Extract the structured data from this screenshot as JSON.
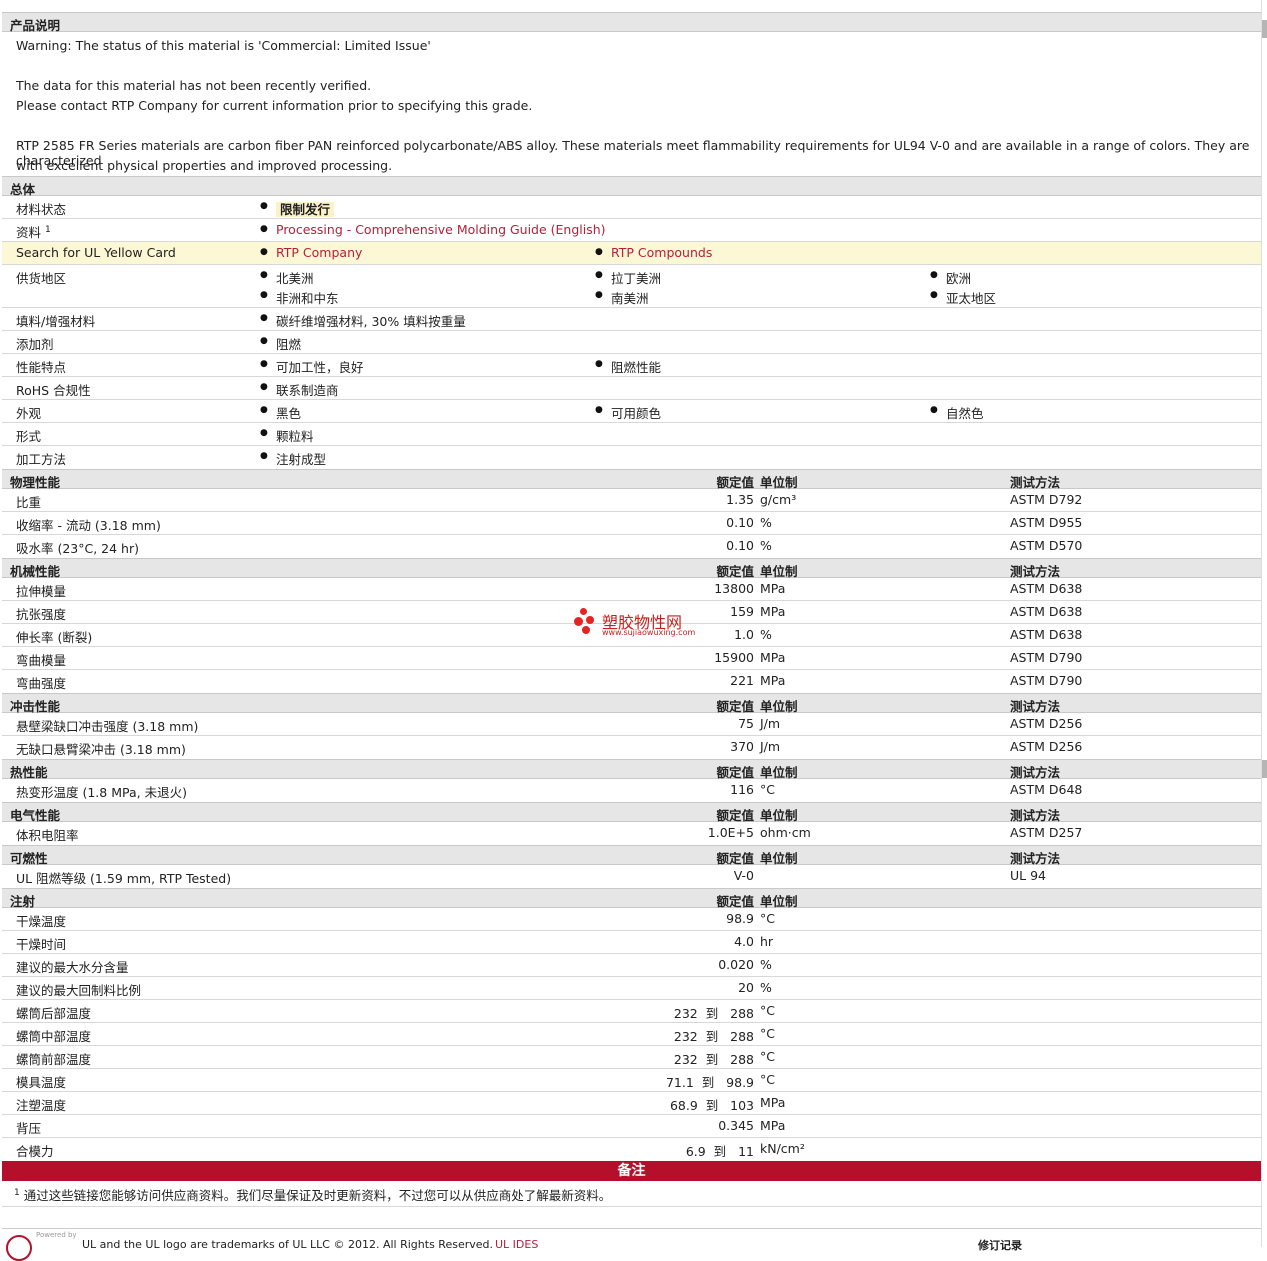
{
  "product": {
    "header": "产品说明",
    "lines": [
      "Warning: The status of this material is 'Commercial: Limited Issue'",
      "The data for this material has not been recently verified.",
      "Please contact RTP Company for current information prior to specifying this grade.",
      "RTP 2585 FR Series materials are carbon fiber PAN reinforced polycarbonate/ABS alloy. These materials meet flammability requirements for UL94 V-0 and are available in a range of colors. They are characterized",
      "with excellent physical properties and improved processing."
    ]
  },
  "general": {
    "header": "总体",
    "status_label": "材料状态",
    "status_value": "限制发行",
    "doc_label": "资料",
    "doc_sup": "1",
    "doc_link": "Processing - Comprehensive Molding Guide (English)",
    "ul_label": "Search for UL Yellow Card",
    "ul_link1": "RTP Company",
    "ul_link2": "RTP Compounds",
    "supply_label": "供货地区",
    "supply": [
      "北美洲",
      "拉丁美洲",
      "欧洲",
      "非洲和中东",
      "南美洲",
      "亚太地区"
    ],
    "filler_label": "填料/增强材料",
    "filler_value": "碳纤维增强材料, 30% 填料按重量",
    "additive_label": "添加剂",
    "additive_value": "阻燃",
    "features_label": "性能特点",
    "features": [
      "可加工性，良好",
      "阻燃性能"
    ],
    "rohs_label": "RoHS 合规性",
    "rohs_value": "联系制造商",
    "appearance_label": "外观",
    "appearance": [
      "黑色",
      "可用颜色",
      "自然色"
    ],
    "form_label": "形式",
    "form_value": "颗粒料",
    "method_label": "加工方法",
    "method_value": "注射成型"
  },
  "col_headers": {
    "nominal": "额定值",
    "unit": "单位制",
    "test": "测试方法"
  },
  "physical": {
    "header": "物理性能",
    "rows": [
      {
        "label": "比重",
        "value": "1.35",
        "unit": "g/cm³",
        "method": "ASTM D792"
      },
      {
        "label": "收缩率  - 流动  (3.18 mm)",
        "value": "0.10",
        "unit": "%",
        "method": "ASTM D955"
      },
      {
        "label": "吸水率  (23°C, 24 hr)",
        "value": "0.10",
        "unit": "%",
        "method": "ASTM D570"
      }
    ]
  },
  "mechanical": {
    "header": "机械性能",
    "rows": [
      {
        "label": "拉伸模量",
        "value": "13800",
        "unit": "MPa",
        "method": "ASTM D638"
      },
      {
        "label": "抗张强度",
        "value": "159",
        "unit": "MPa",
        "method": "ASTM D638"
      },
      {
        "label": "伸长率  (断裂)",
        "value": "1.0",
        "unit": "%",
        "method": "ASTM D638"
      },
      {
        "label": "弯曲模量",
        "value": "15900",
        "unit": "MPa",
        "method": "ASTM D790"
      },
      {
        "label": "弯曲强度",
        "value": "221",
        "unit": "MPa",
        "method": "ASTM D790"
      }
    ]
  },
  "impact": {
    "header": "冲击性能",
    "rows": [
      {
        "label": "悬壁梁缺口冲击强度  (3.18 mm)",
        "value": "75",
        "unit": "J/m",
        "method": "ASTM D256"
      },
      {
        "label": "无缺口悬臂梁冲击  (3.18 mm)",
        "value": "370",
        "unit": "J/m",
        "method": "ASTM D256"
      }
    ]
  },
  "thermal": {
    "header": "热性能",
    "rows": [
      {
        "label": "热变形温度  (1.8 MPa, 未退火)",
        "value": "116",
        "unit": "°C",
        "method": "ASTM D648"
      }
    ]
  },
  "electrical": {
    "header": "电气性能",
    "rows": [
      {
        "label": "体积电阻率",
        "value": "1.0E+5",
        "unit": "ohm·cm",
        "method": "ASTM D257"
      }
    ]
  },
  "flammability": {
    "header": "可燃性",
    "rows": [
      {
        "label": "UL 阻燃等级  (1.59 mm, RTP Tested)",
        "value": "V-0",
        "unit": "",
        "method": "UL 94"
      }
    ]
  },
  "injection": {
    "header": "注射",
    "rows": [
      {
        "label": "干燥温度",
        "value": "98.9",
        "unit": "°C"
      },
      {
        "label": "干燥时间",
        "value": "4.0",
        "unit": "hr"
      },
      {
        "label": "建议的最大水分含量",
        "value": "0.020",
        "unit": "%"
      },
      {
        "label": "建议的最大回制料比例",
        "value": "20",
        "unit": "%"
      },
      {
        "label": "螺筒后部温度",
        "value": "232  到   288",
        "unit": "°C"
      },
      {
        "label": "螺筒中部温度",
        "value": "232  到   288",
        "unit": "°C"
      },
      {
        "label": "螺筒前部温度",
        "value": "232  到   288",
        "unit": "°C"
      },
      {
        "label": "模具温度",
        "value": "71.1  到   98.9",
        "unit": "°C"
      },
      {
        "label": "注塑温度",
        "value": "68.9  到   103",
        "unit": "MPa"
      },
      {
        "label": "背压",
        "value": "0.345",
        "unit": "MPa"
      },
      {
        "label": "合模力",
        "value": "6.9  到   11",
        "unit": "kN/cm²"
      }
    ]
  },
  "notes": {
    "header": "备注",
    "sup": "1",
    "text": "通过这些链接您能够访问供应商资料。我们尽量保证及时更新资料，不过您可以从供应商处了解最新资料。"
  },
  "footer": {
    "powered": "Powered by",
    "text": "UL and the UL logo are trademarks of UL LLC © 2012. All Rights Reserved.",
    "ul_link": "UL IDES",
    "revision": "修订记录"
  },
  "watermark": {
    "title": "塑胶物性网",
    "url": "www.sujiaowuxing.com"
  },
  "colors": {
    "accent": "#b50f2c",
    "link": "#b5203c",
    "header_bg": "#e6e6e6",
    "highlight": "#fcf7d4"
  }
}
